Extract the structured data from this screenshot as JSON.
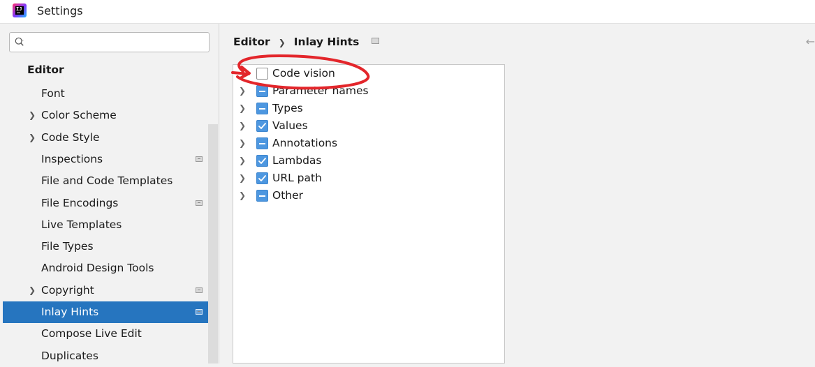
{
  "window": {
    "title": "Settings",
    "app_icon_text": "IJ"
  },
  "search": {
    "placeholder": ""
  },
  "sidebar": {
    "section": "Editor",
    "items": [
      {
        "label": "Font",
        "expandable": false,
        "has_mark": false,
        "selected": false
      },
      {
        "label": "Color Scheme",
        "expandable": true,
        "has_mark": false,
        "selected": false
      },
      {
        "label": "Code Style",
        "expandable": true,
        "has_mark": false,
        "selected": false
      },
      {
        "label": "Inspections",
        "expandable": false,
        "has_mark": true,
        "selected": false
      },
      {
        "label": "File and Code Templates",
        "expandable": false,
        "has_mark": false,
        "selected": false
      },
      {
        "label": "File Encodings",
        "expandable": false,
        "has_mark": true,
        "selected": false
      },
      {
        "label": "Live Templates",
        "expandable": false,
        "has_mark": false,
        "selected": false
      },
      {
        "label": "File Types",
        "expandable": false,
        "has_mark": false,
        "selected": false
      },
      {
        "label": "Android Design Tools",
        "expandable": false,
        "has_mark": false,
        "selected": false
      },
      {
        "label": "Copyright",
        "expandable": true,
        "has_mark": true,
        "selected": false
      },
      {
        "label": "Inlay Hints",
        "expandable": false,
        "has_mark": true,
        "selected": true
      },
      {
        "label": "Compose Live Edit",
        "expandable": false,
        "has_mark": false,
        "selected": false
      },
      {
        "label": "Duplicates",
        "expandable": false,
        "has_mark": false,
        "selected": false
      }
    ]
  },
  "breadcrumb": {
    "parent": "Editor",
    "current": "Inlay Hints"
  },
  "hints": [
    {
      "label": "Code vision",
      "state": "unchecked"
    },
    {
      "label": "Parameter names",
      "state": "partial"
    },
    {
      "label": "Types",
      "state": "partial"
    },
    {
      "label": "Values",
      "state": "checked"
    },
    {
      "label": "Annotations",
      "state": "partial"
    },
    {
      "label": "Lambdas",
      "state": "checked"
    },
    {
      "label": "URL path",
      "state": "checked"
    },
    {
      "label": "Other",
      "state": "partial"
    }
  ],
  "colors": {
    "selection": "#2675bf",
    "checkbox": "#4d97e0",
    "annotation": "#e3262b"
  }
}
